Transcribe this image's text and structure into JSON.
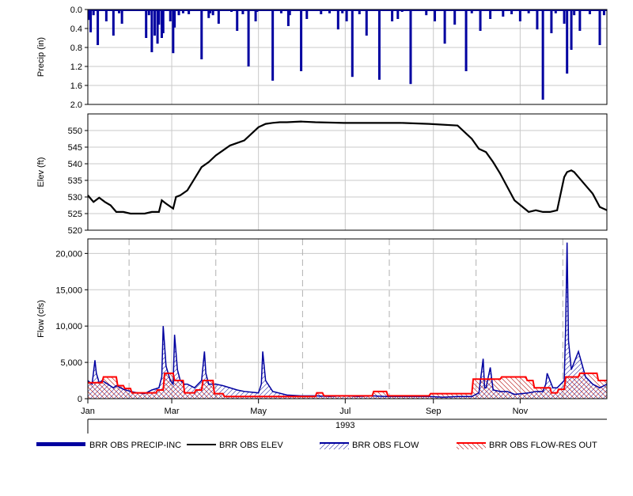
{
  "chart_data": {
    "type": "line",
    "x_axis": {
      "months": [
        "Jan",
        "Mar",
        "May",
        "Jul",
        "Sep",
        "Nov"
      ],
      "year_label": "1993",
      "range_days": [
        0,
        365
      ]
    },
    "panels": [
      {
        "id": "precip",
        "type": "bar",
        "ylabel": "Precip (in)",
        "ylim": [
          2.0,
          0.0
        ],
        "inverted": true,
        "yticks": [
          "0.0",
          "0.4",
          "0.8",
          "1.2",
          "1.6",
          "2.0"
        ],
        "series": [
          {
            "name": "BRR OBS PRECIP-INC",
            "color": "#0000a0",
            "day": [
              1,
              2,
              4,
              7,
              13,
              18,
              22,
              24,
              41,
              43,
              45,
              47,
              49,
              50,
              52,
              53,
              58,
              60,
              61,
              64,
              67,
              71,
              80,
              85,
              86,
              88,
              92,
              101,
              105,
              109,
              113,
              118,
              119,
              130,
              136,
              141,
              142,
              150,
              154,
              164,
              170,
              176,
              179,
              182,
              186,
              191,
              196,
              205,
              214,
              218,
              221,
              227,
              238,
              244,
              251,
              258,
              266,
              270,
              276,
              283,
              292,
              298,
              304,
              310,
              316,
              320,
              326,
              329,
              335,
              337,
              340,
              342,
              346,
              353,
              360,
              363
            ],
            "values": [
              0.22,
              0.48,
              0.12,
              0.75,
              0.25,
              0.55,
              0.08,
              0.3,
              0.6,
              0.12,
              0.9,
              0.55,
              0.72,
              0.32,
              0.6,
              0.5,
              0.25,
              0.92,
              0.38,
              0.12,
              0.08,
              0.1,
              1.05,
              0.18,
              0.08,
              0.12,
              0.3,
              0.05,
              0.45,
              0.1,
              1.2,
              0.25,
              0.05,
              1.5,
              0.08,
              0.35,
              0.12,
              1.3,
              0.2,
              0.1,
              0.08,
              0.42,
              0.08,
              0.25,
              1.42,
              0.1,
              0.55,
              1.48,
              0.25,
              0.2,
              0.05,
              1.57,
              0.12,
              0.25,
              0.72,
              0.32,
              1.3,
              0.08,
              0.45,
              0.2,
              0.15,
              0.1,
              0.25,
              0.08,
              0.42,
              1.9,
              0.5,
              0.08,
              0.3,
              1.35,
              0.85,
              0.12,
              0.45,
              0.1,
              0.75,
              0.12
            ]
          }
        ]
      },
      {
        "id": "elev",
        "type": "line",
        "ylabel": "Elev (ft)",
        "ylim": [
          520,
          555
        ],
        "yticks": [
          "520",
          "525",
          "530",
          "535",
          "540",
          "545",
          "550"
        ],
        "series": [
          {
            "name": "BRR OBS ELEV",
            "color": "#000000",
            "x": [
              0,
              2,
              4,
              8,
              12,
              16,
              20,
              25,
              30,
              35,
              40,
              45,
              50,
              52,
              55,
              60,
              62,
              65,
              70,
              75,
              80,
              85,
              90,
              95,
              100,
              110,
              120,
              125,
              130,
              135,
              140,
              150,
              160,
              180,
              200,
              220,
              240,
              260,
              270,
              275,
              280,
              285,
              290,
              295,
              300,
              310,
              315,
              320,
              325,
              330,
              335,
              337,
              340,
              342,
              345,
              350,
              355,
              360,
              365
            ],
            "values": [
              530.5,
              529.5,
              528.5,
              529.8,
              528.5,
              527.5,
              525.5,
              525.5,
              525.0,
              525.0,
              525.0,
              525.5,
              525.5,
              529.0,
              528.0,
              526.5,
              530.0,
              530.5,
              532.0,
              535.5,
              539.0,
              540.5,
              542.5,
              544.0,
              545.5,
              547.0,
              551.0,
              552.0,
              552.3,
              552.5,
              552.5,
              552.7,
              552.5,
              552.3,
              552.3,
              552.3,
              552.0,
              551.5,
              547.5,
              544.5,
              543.5,
              540.5,
              537.0,
              533.0,
              529.0,
              525.5,
              526.0,
              525.5,
              525.5,
              526.0,
              536.0,
              537.5,
              538.0,
              537.5,
              536.0,
              533.5,
              531.0,
              527.0,
              526.0
            ]
          }
        ]
      },
      {
        "id": "flow",
        "type": "area",
        "ylabel": "Flow (cfs)",
        "ylim": [
          0,
          22000
        ],
        "yticks": [
          "0",
          "5,000",
          "10,000",
          "15,000",
          "20,000"
        ],
        "series": [
          {
            "name": "BRR OBS FLOW",
            "color": "#0000a0",
            "x": [
              0,
              3,
              5,
              6,
              8,
              10,
              14,
              18,
              20,
              25,
              30,
              35,
              40,
              45,
              50,
              52,
              53,
              55,
              58,
              60,
              61,
              63,
              65,
              68,
              70,
              75,
              80,
              82,
              83,
              85,
              90,
              95,
              100,
              105,
              110,
              115,
              120,
              122,
              123,
              125,
              130,
              140,
              150,
              160,
              170,
              180,
              190,
              200,
              210,
              220,
              230,
              240,
              250,
              260,
              270,
              275,
              278,
              279,
              280,
              283,
              285,
              290,
              295,
              300,
              305,
              310,
              315,
              320,
              322,
              323,
              325,
              327,
              330,
              335,
              336,
              337,
              338,
              340,
              345,
              350,
              355,
              360,
              365
            ],
            "values": [
              2500,
              2000,
              5300,
              3500,
              2200,
              2500,
              2000,
              1500,
              1800,
              1300,
              1000,
              800,
              700,
              1200,
              1500,
              3000,
              10000,
              4500,
              2500,
              2000,
              8800,
              4000,
              2500,
              2000,
              2000,
              1500,
              2500,
              6500,
              3500,
              2000,
              2000,
              1800,
              1500,
              1200,
              1000,
              900,
              800,
              2000,
              6500,
              2500,
              1000,
              500,
              400,
              400,
              300,
              400,
              300,
              400,
              300,
              300,
              300,
              300,
              200,
              300,
              300,
              800,
              5500,
              1500,
              1500,
              4300,
              1200,
              1000,
              1000,
              600,
              700,
              800,
              1000,
              1000,
              2000,
              3500,
              2500,
              1500,
              1500,
              2500,
              10000,
              21500,
              8000,
              4000,
              6500,
              3000,
              2000,
              1500,
              2000
            ]
          },
          {
            "name": "BRR OBS FLOW-RES OUT",
            "color": "#ff0000",
            "x": [
              0,
              10,
              11,
              20,
              21,
              25,
              26,
              30,
              31,
              48,
              49,
              53,
              54,
              60,
              61,
              67,
              68,
              75,
              76,
              80,
              81,
              88,
              89,
              95,
              96,
              160,
              161,
              165,
              166,
              200,
              201,
              210,
              211,
              240,
              241,
              270,
              271,
              290,
              291,
              308,
              309,
              313,
              314,
              325,
              326,
              330,
              331,
              335,
              336,
              345,
              346,
              358,
              359,
              365
            ],
            "values": [
              2200,
              2200,
              3000,
              3000,
              1800,
              1800,
              1400,
              1400,
              800,
              800,
              1200,
              1200,
              3500,
              3500,
              2500,
              2500,
              800,
              800,
              1200,
              1200,
              2500,
              2500,
              700,
              700,
              300,
              300,
              800,
              800,
              400,
              400,
              1000,
              1000,
              400,
              400,
              700,
              700,
              2700,
              2700,
              3000,
              3000,
              2500,
              2500,
              1500,
              1500,
              800,
              800,
              1300,
              1300,
              3000,
              3000,
              3500,
              3500,
              2500,
              2500
            ]
          }
        ]
      }
    ],
    "legend": {
      "placement": "bottom",
      "items": [
        {
          "label": "BRR OBS PRECIP-INC",
          "style": "thick-bar",
          "color": "#0000a0"
        },
        {
          "label": "BRR OBS ELEV",
          "style": "line",
          "color": "#000000"
        },
        {
          "label": "BRR OBS FLOW",
          "style": "hatched-area",
          "color": "#0000a0"
        },
        {
          "label": "BRR OBS FLOW-RES OUT",
          "style": "hatched-area",
          "color": "#ff0000"
        }
      ]
    },
    "grid": true
  }
}
